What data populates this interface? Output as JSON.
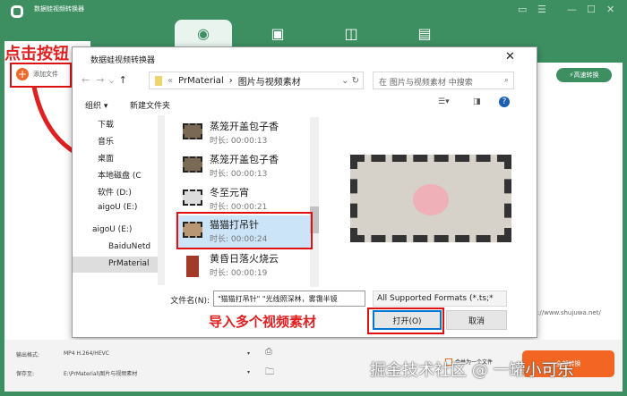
{
  "app": {
    "title": "数据蛙视频转换器",
    "fast_convert": "高速转换",
    "url": "https://www.shujuwa.net/",
    "add_file": "添加文件"
  },
  "tabs": [
    {
      "icon": "convert-icon"
    },
    {
      "icon": "tv-icon"
    },
    {
      "icon": "layout-icon"
    },
    {
      "icon": "toolbox-icon"
    }
  ],
  "annotations": {
    "click_button": "点击按钮",
    "import_multiple": "导入多个视频素材"
  },
  "dialog": {
    "title": "数据蛙视频转换器",
    "path": [
      "«",
      "PrMaterial",
      "›",
      "图片与视频素材"
    ],
    "search_placeholder": "在 图片与视频素材 中搜索",
    "organize": "组织 ▾",
    "new_folder": "新建文件夹",
    "nav_items": [
      "下载",
      "音乐",
      "桌面",
      "本地磁盘 (C",
      "软件 (D:)",
      "aigoU (E:)",
      "aigoU (E:)",
      "BaiduNetd",
      "PrMaterial"
    ],
    "files": [
      {
        "name": "蒸笼开盖包子香",
        "duration": "时长: 00:00:13"
      },
      {
        "name": "蒸笼开盖包子香",
        "duration": "时长: 00:00:13"
      },
      {
        "name": "冬至元宵",
        "duration": "时长: 00:00:21"
      },
      {
        "name": "猫猫打吊针",
        "duration": "时长: 00:00:24"
      },
      {
        "name": "黄昏日落火烧云",
        "duration": "时长: 00:00:19"
      }
    ],
    "filename_label": "文件名(N):",
    "filename_value": "\"猫猫打吊针\" \"光线照深林，雾霭半镜",
    "filter": "All Supported Formats (*.ts;*",
    "open": "打开(O)",
    "cancel": "取消"
  },
  "bottom": {
    "output_label": "输出格式:",
    "output_value": "MP4 H.264/HEVC",
    "save_label": "保存至:",
    "save_value": "E:\\PrMaterial\\图片与视频素材",
    "merge": "合并为一个文件",
    "convert_all": "全部转换"
  },
  "watermark": "掘金技术社区 @ 一罐小可乐"
}
